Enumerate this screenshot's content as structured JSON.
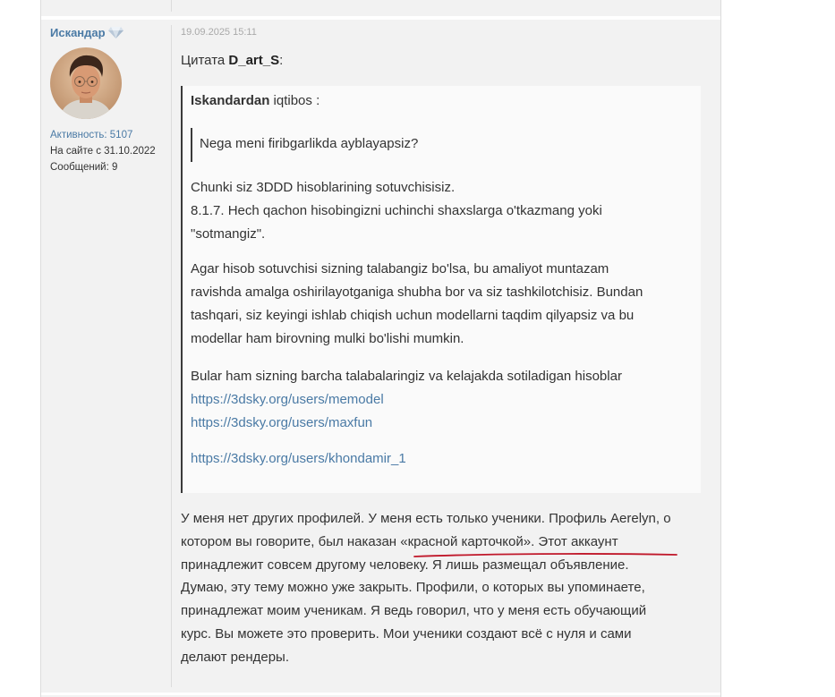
{
  "post": {
    "username": "Искандар",
    "user_stats": {
      "activity": "Активность: 5107",
      "member_since": "На сайте с 31.10.2022",
      "messages": "Сообщений: 9"
    },
    "date": "19.09.2025 15:11",
    "quote_prefix": "Цитата",
    "quote_author": "D_art_S",
    "quote_suffix": ":",
    "quote": {
      "title_author": "Iskandardan",
      "title_suffix": " iqtibos :",
      "nested_quote": "Nega meni firibgarlikda ayblayapsiz?",
      "para1": [
        "Chunki siz 3DDD hisoblarining sotuvchisisiz.",
        "8.1.7. Hech qachon hisobingizni uchinchi shaxslarga o'tkazmang yoki",
        "\"sotmangiz\"."
      ],
      "para2": [
        "Agar hisob sotuvchisi sizning talabangiz bo'lsa, bu amaliyot muntazam",
        "ravishda amalga oshirilayotganiga shubha bor va siz tashkilotchisiz. Bundan",
        "tashqari, siz keyingi ishlab chiqish uchun modellarni taqdim qilyapsiz va bu",
        "modellar ham birovning mulki bo'lishi mumkin."
      ],
      "para3": "Bular ham sizning barcha talabalaringiz va kelajakda sotiladigan hisoblar",
      "links": [
        "https://3dsky.org/users/memodel",
        "https://3dsky.org/users/maxfun",
        "https://3dsky.org/users/khondamir_1"
      ]
    },
    "reply_lines": [
      "У меня нет других профилей. У меня есть только ученики. Профиль Aerelyn, о",
      "котором вы говорите, был наказан «красной карточкой». Этот аккаунт",
      "принадлежит совсем другому человеку. ",
      "Я лишь размещал объявление.",
      "Думаю, эту тему можно уже закрыть. Профили, о которых вы упоминаете,",
      "принадлежат моим ученикам. Я ведь говорил, что у меня есть обучающий",
      "курс. Вы можете это проверить. Мои ученики создают всё с нуля и сами",
      "делают рендеры."
    ]
  },
  "colors": {
    "link": "#4a7aa5",
    "underline_annotation": "#c0182a",
    "quote_border": "#3a3a3a"
  }
}
